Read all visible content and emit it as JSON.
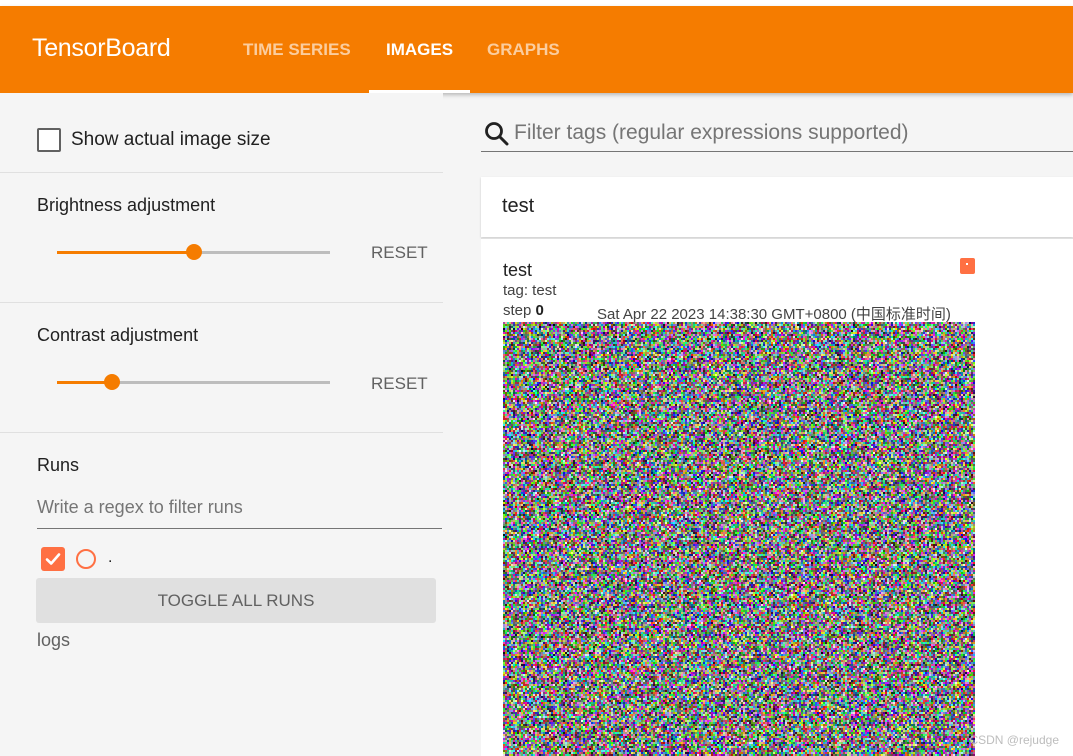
{
  "header": {
    "brand": "TensorBoard",
    "tabs": [
      {
        "label": "TIME SERIES",
        "active": false
      },
      {
        "label": "IMAGES",
        "active": true
      },
      {
        "label": "GRAPHS",
        "active": false
      }
    ],
    "accent_color": "#f57c00"
  },
  "sidebar": {
    "show_actual_size_label": "Show actual image size",
    "show_actual_size_checked": false,
    "brightness": {
      "title": "Brightness adjustment",
      "reset_label": "RESET",
      "level": 0.5
    },
    "contrast": {
      "title": "Contrast adjustment",
      "reset_label": "RESET",
      "level": 0.2
    },
    "runs": {
      "title": "Runs",
      "filter_placeholder": "Write a regex to filter runs",
      "items": [
        {
          "label": ".",
          "checked": true,
          "color": "#ff7043"
        }
      ],
      "toggle_all_label": "TOGGLE ALL RUNS",
      "logdir": "logs"
    }
  },
  "main": {
    "filter_placeholder": "Filter tags (regular expressions supported)",
    "filter_icon": "search-icon",
    "group": {
      "title": "test"
    },
    "card": {
      "title": "test",
      "tag_label": "tag: test",
      "step_prefix": "step",
      "step_value": "0",
      "timestamp": "Sat Apr 22 2023 14:38:30 GMT+0800 (中国标准时间)",
      "run_color": "#ff7043"
    }
  },
  "watermark": "CSDN @rejudge"
}
